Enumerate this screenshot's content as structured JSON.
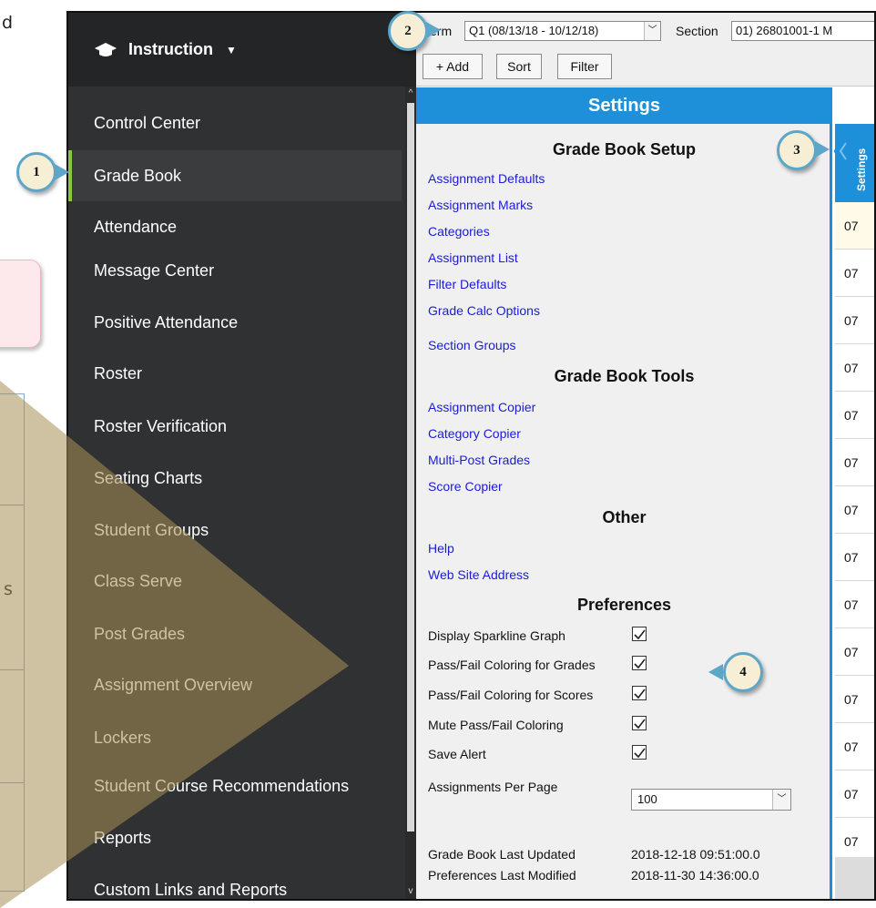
{
  "doc": {
    "frag_top": "d",
    "frag_mid": "s"
  },
  "app": {
    "sidebar": {
      "header": "Instruction",
      "items": [
        {
          "label": "Control Center"
        },
        {
          "label": "Grade Book"
        },
        {
          "label": "Attendance"
        },
        {
          "label": "Message Center"
        },
        {
          "label": "Positive Attendance"
        },
        {
          "label": "Roster"
        },
        {
          "label": "Roster Verification"
        },
        {
          "label": "Seating Charts"
        },
        {
          "label": "Student Groups"
        },
        {
          "label": "Class Serve"
        },
        {
          "label": "Post Grades"
        },
        {
          "label": "Assignment Overview"
        },
        {
          "label": "Lockers"
        },
        {
          "label": "Student Course Recommendations"
        },
        {
          "label": "Reports"
        },
        {
          "label": "Custom Links and Reports"
        }
      ],
      "active_item": "Grade Book"
    },
    "toolbar": {
      "term_label": "Term",
      "term_value": "Q1 (08/13/18 - 10/12/18)",
      "section_label": "Section",
      "section_value": "01) 26801001-1 M",
      "add_label": "+ Add",
      "sort_label": "Sort",
      "filter_label": "Filter"
    },
    "settings": {
      "title": "Settings",
      "setup_heading": "Grade Book Setup",
      "setup_links": [
        "Assignment Defaults",
        "Assignment Marks",
        "Categories",
        "Assignment List",
        "Filter Defaults",
        "Grade Calc Options",
        "Section Groups"
      ],
      "tools_heading": "Grade Book Tools",
      "tools_links": [
        "Assignment Copier",
        "Category Copier",
        "Multi-Post Grades",
        "Score Copier"
      ],
      "other_heading": "Other",
      "other_links": [
        "Help",
        "Web Site Address"
      ],
      "prefs_heading": "Preferences",
      "prefs": [
        {
          "label": "Display Sparkline Graph",
          "checked": true
        },
        {
          "label": "Pass/Fail Coloring for Grades",
          "checked": true
        },
        {
          "label": "Pass/Fail Coloring for Scores",
          "checked": true
        },
        {
          "label": "Mute Pass/Fail Coloring",
          "checked": true
        },
        {
          "label": "Save Alert",
          "checked": true
        }
      ],
      "per_page_label": "Assignments Per Page",
      "per_page_value": "100",
      "last_updated_label": "Grade Book Last Updated",
      "last_updated_value": "2018-12-18 09:51:00.0",
      "prefs_modified_label": "Preferences Last Modified",
      "prefs_modified_value": "2018-11-30 14:36:00.0"
    },
    "grid": {
      "tab_label": "Settings",
      "cells": [
        "07",
        "07",
        "07",
        "07",
        "07",
        "07",
        "07",
        "07",
        "07",
        "07",
        "07",
        "07",
        "07",
        "07"
      ]
    }
  },
  "callouts": [
    "1",
    "2",
    "3",
    "4"
  ],
  "colors": {
    "accent_blue": "#1e90d9",
    "sidebar_bg": "#2f3133",
    "active_indicator": "#8cc63f",
    "link_blue": "#1b1bd8",
    "badge_fill": "#f7efd5",
    "badge_border": "#5ca6c9",
    "arrow_tan": "#c8b48a"
  }
}
